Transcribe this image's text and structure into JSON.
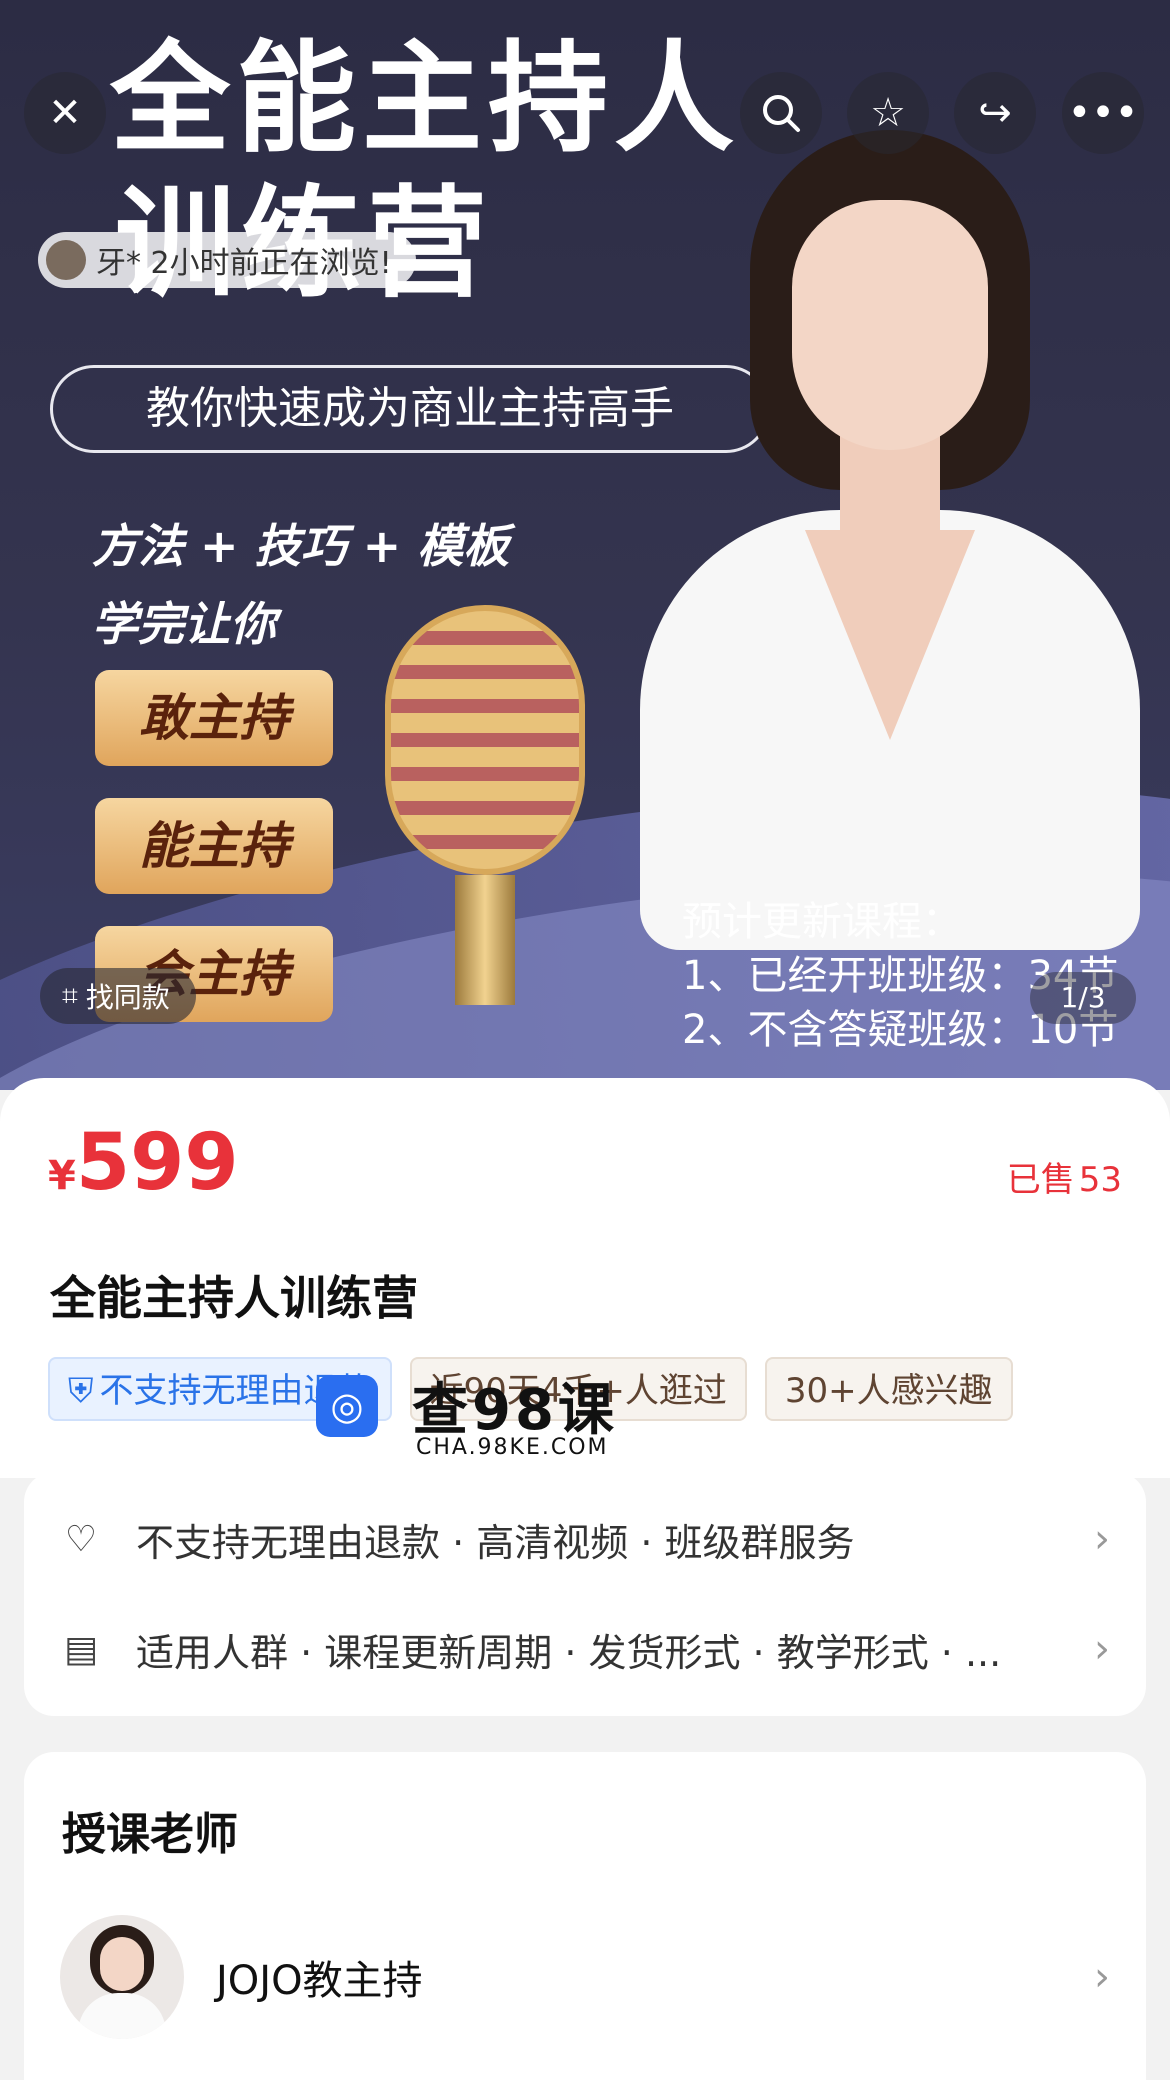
{
  "banner": {
    "title_line1": "全能主持人",
    "title_line2": "训练营",
    "tagline": "教你快速成为商业主持高手",
    "formula": "方法 + 技巧 + 模板",
    "learn": "学完让你",
    "badges": [
      "敢主持",
      "能主持",
      "会主持"
    ],
    "update_heading": "预计更新课程：",
    "update_items": [
      "1、已经开班班级：34节",
      "2、不含答疑班级：10节"
    ]
  },
  "overlay": {
    "browsing_text": "牙* 2小时前正在浏览!",
    "find_similar": "找同款",
    "page_indicator": "1/3"
  },
  "price": {
    "currency": "¥",
    "amount": "599",
    "sold_label": "已售",
    "sold_count": "53"
  },
  "product": {
    "title": "全能主持人训练营"
  },
  "tags": [
    {
      "text": "不支持无理由退款",
      "style": "blue"
    },
    {
      "text": "近90天4千+人逛过",
      "style": "warm"
    },
    {
      "text": "30+人感兴趣",
      "style": "warm"
    }
  ],
  "watermark": {
    "name": "查98课",
    "url": "CHA.98KE.COM"
  },
  "services": [
    {
      "icon": "heart-shield-icon",
      "text": "不支持无理由退款 · 高清视频 · 班级群服务"
    },
    {
      "icon": "clipboard-icon",
      "text": "适用人群 · 课程更新周期 · 发货形式 · 教学形式 · ..."
    }
  ],
  "teacher": {
    "heading": "授课老师",
    "name": "JOJO教主持"
  },
  "colors": {
    "price_red": "#e8323a",
    "banner_bg": "#2c2c44",
    "tag_blue": "#2a73e8"
  }
}
